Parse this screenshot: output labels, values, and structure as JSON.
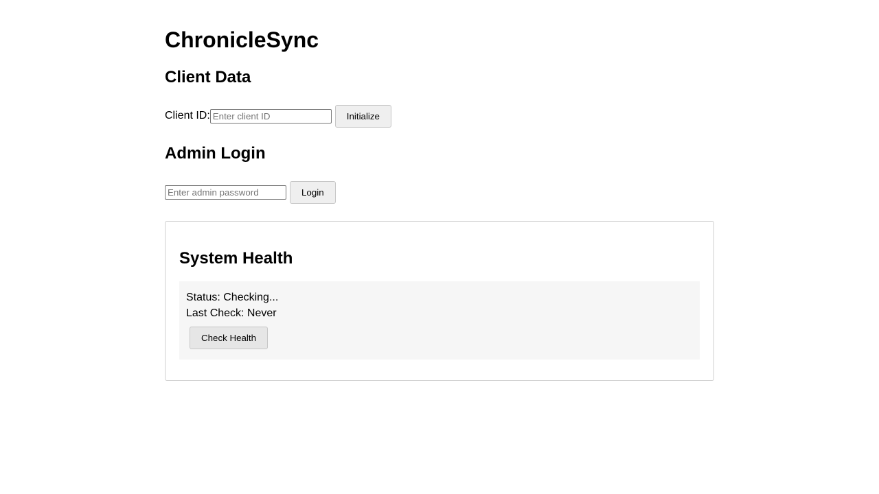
{
  "app": {
    "title": "ChronicleSync"
  },
  "client_data": {
    "heading": "Client Data",
    "client_id_label": "Client ID:",
    "client_id_value": "",
    "client_id_placeholder": "Enter client ID",
    "initialize_label": "Initialize"
  },
  "admin_login": {
    "heading": "Admin Login",
    "password_value": "",
    "password_placeholder": "Enter admin password",
    "login_label": "Login"
  },
  "system_health": {
    "heading": "System Health",
    "status_text": "Status: Checking...",
    "last_check_text": "Last Check: Never",
    "check_button_label": "Check Health"
  }
}
